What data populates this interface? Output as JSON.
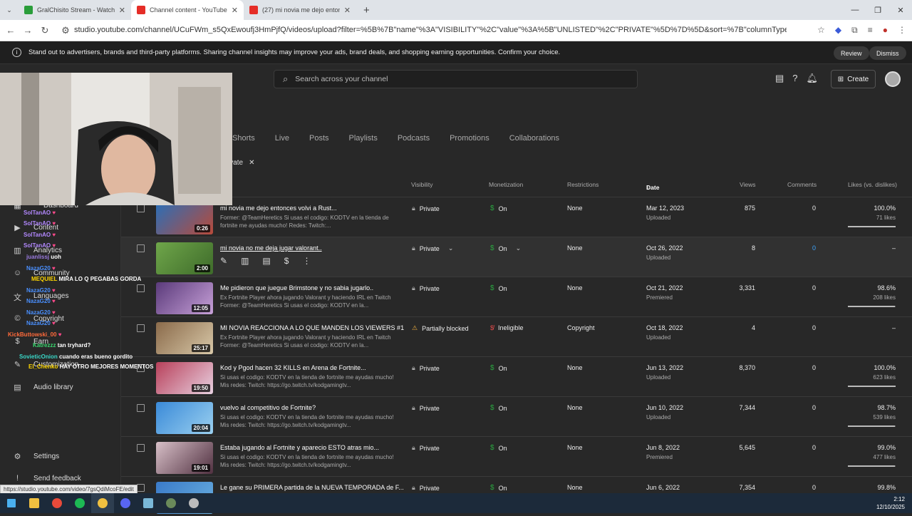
{
  "browser": {
    "tabs": [
      {
        "title": "GralChisito Stream - Watch Live",
        "color": "#2a9d3a"
      },
      {
        "title": "Channel content - YouTube Studio",
        "color": "#e52d27"
      },
      {
        "title": "(27) mi novia me dejo entonces...",
        "color": "#e52d27"
      }
    ],
    "url": "studio.youtube.com/channel/UCuFWm_s5QxEwoufj3HmPjfQ/videos/upload?filter=%5B%7B\"name\"%3A\"VISIBILITY\"%2C\"value\"%3A%5B\"UNLISTED\"%2C\"PRIVATE\"%5D%7D%5D&sort=%7B\"columnType\"%3A\"date\"%2C\"sortOrder\"%3A\"DESCEN..."
  },
  "banner": {
    "text": "Stand out to advertisers, brands and third-party platforms. Sharing channel insights may improve your ads, brand deals, and shopping earning opportunities. Confirm your choice.",
    "review": "Review",
    "dismiss": "Dismiss"
  },
  "header": {
    "search_placeholder": "Search across your channel",
    "create": "Create"
  },
  "tabs": [
    "Shorts",
    "Live",
    "Posts",
    "Playlists",
    "Podcasts",
    "Promotions",
    "Collaborations"
  ],
  "filter_chip": "ivate",
  "sidebar": {
    "items": [
      {
        "label": "Dashboard"
      },
      {
        "label": "Content"
      },
      {
        "label": "Analytics"
      },
      {
        "label": "Community"
      },
      {
        "label": "Languages"
      },
      {
        "label": "Copyright"
      },
      {
        "label": "Earn"
      },
      {
        "label": "Customization"
      },
      {
        "label": "Audio library"
      },
      {
        "label": "Settings"
      },
      {
        "label": "Send feedback"
      }
    ]
  },
  "columns": {
    "visibility": "Visibility",
    "monetization": "Monetization",
    "restrictions": "Restrictions",
    "date": "Date",
    "views": "Views",
    "comments": "Comments",
    "likes": "Likes (vs. dislikes)"
  },
  "rows": [
    {
      "title": "mi novia me dejo entonces volvi a Rust...",
      "desc": "Former: @TeamHeretics Si usas el codigo: KODTV en la tienda de fortnite me ayudas mucho! Redes: Twitch:...",
      "dur": "0:26",
      "vis": "Private",
      "mon": "On",
      "res": "None",
      "date": "Mar 12, 2023",
      "dsub": "Uploaded",
      "views": "875",
      "com": "0",
      "likes": "100.0%",
      "lsub": "71 likes",
      "pct": 1.0,
      "t1": "#2a6fb8",
      "t2": "#b84a3a"
    },
    {
      "title": "mi novia no me deja jugar valorant..",
      "desc": "",
      "dur": "2:00",
      "vis": "Private",
      "mon": "On",
      "res": "None",
      "date": "Oct 26, 2022",
      "dsub": "Uploaded",
      "views": "8",
      "com": "0",
      "likes": "–",
      "lsub": "",
      "pct": null,
      "t1": "#6fa64a",
      "t2": "#3e6b2a",
      "hover": true
    },
    {
      "title": "Me pidieron que juegue Brimstone y no sabia jugarlo..",
      "desc": "Ex Fortnite Player ahora jugando Valorant y haciendo IRL en Twitch Former: @TeamHeretics Si usas el codigo: KODTV en la...",
      "dur": "12:05",
      "vis": "Private",
      "mon": "On",
      "res": "None",
      "date": "Oct 21, 2022",
      "dsub": "Premiered",
      "views": "3,331",
      "com": "0",
      "likes": "98.6%",
      "lsub": "208 likes",
      "pct": 0.986,
      "t1": "#5a3a7a",
      "t2": "#c7a0d8"
    },
    {
      "title": "MI NOVIA REACCIONA A LO QUE MANDEN LOS VIEWERS #1",
      "desc": "Ex Fortnite Player ahora jugando Valorant y haciendo IRL en Twitch Former: @TeamHeretics Si usas el codigo: KODTV en la...",
      "dur": "25:17",
      "vis": "Partially blocked",
      "mon": "Ineligible",
      "res": "Copyright",
      "date": "Oct 18, 2022",
      "dsub": "Uploaded",
      "views": "4",
      "com": "0",
      "likes": "–",
      "lsub": "",
      "pct": null,
      "t1": "#8a6a4a",
      "t2": "#d8c8a8",
      "blocked": true
    },
    {
      "title": "Kod y Pgod hacen 32 KILLS en Arena de Fortnite...",
      "desc": "Si usas el codigo: KODTV en la tienda de fortnite me ayudas mucho! Mis redes: Twitch: https://go.twitch.tv/kodgamingtv...",
      "dur": "19:50",
      "vis": "Private",
      "mon": "On",
      "res": "None",
      "date": "Jun 13, 2022",
      "dsub": "Uploaded",
      "views": "8,370",
      "com": "0",
      "likes": "100.0%",
      "lsub": "623 likes",
      "pct": 1.0,
      "t1": "#b8405a",
      "t2": "#e8d0e0"
    },
    {
      "title": "vuelvo al competitivo de Fortnite?",
      "desc": "Si usas el codigo: KODTV en la tienda de fortnite me ayudas mucho! Mis redes: Twitch: https://go.twitch.tv/kodgamingtv...",
      "dur": "20:04",
      "vis": "Private",
      "mon": "On",
      "res": "None",
      "date": "Jun 10, 2022",
      "dsub": "Uploaded",
      "views": "7,344",
      "com": "0",
      "likes": "98.7%",
      "lsub": "539 likes",
      "pct": 0.987,
      "t1": "#3a8ad8",
      "t2": "#9ad0f0"
    },
    {
      "title": "Estaba jugando al Fortnite y aparecio ESTO atras mio...",
      "desc": "Si usas el codigo: KODTV en la tienda de fortnite me ayudas mucho! Mis redes: Twitch: https://go.twitch.tv/kodgamingtv...",
      "dur": "19:01",
      "vis": "Private",
      "mon": "On",
      "res": "None",
      "date": "Jun 8, 2022",
      "dsub": "Premiered",
      "views": "5,645",
      "com": "0",
      "likes": "99.0%",
      "lsub": "477 likes",
      "pct": 0.99,
      "t1": "#d8c0c8",
      "t2": "#503040"
    },
    {
      "title": "Le gane su PRIMERA partida de la NUEVA TEMPORADA de F...",
      "desc": "",
      "dur": "",
      "vis": "Private",
      "mon": "On",
      "res": "None",
      "date": "Jun 6, 2022",
      "dsub": "",
      "views": "7,354",
      "com": "0",
      "likes": "99.8%",
      "lsub": "",
      "pct": null,
      "t1": "#3a7ac8",
      "t2": "#6ab0e0"
    }
  ],
  "chat": [
    {
      "u": "SolTanAO",
      "m": "",
      "c": "#b388ff"
    },
    {
      "u": "SolTanAO",
      "m": "",
      "c": "#b388ff"
    },
    {
      "u": "SolTanAO",
      "m": "",
      "c": "#b388ff"
    },
    {
      "u": "SolTanAO",
      "m": "",
      "c": "#b388ff"
    },
    {
      "u": "juanlissj",
      "m": "uoh",
      "c": "#9a7adf"
    },
    {
      "u": "NazaG20",
      "m": "",
      "c": "#4a90ff"
    },
    {
      "u": "MEQUIEL",
      "m": "MIRA LO Q PEGABAS GORDA",
      "c": "#ffd700"
    },
    {
      "u": "NazaG20",
      "m": "",
      "c": "#4a90ff"
    },
    {
      "u": "NazaG20",
      "m": "",
      "c": "#4a90ff"
    },
    {
      "u": "NazaG20",
      "m": "",
      "c": "#4a90ff"
    },
    {
      "u": "NazaG20",
      "m": "",
      "c": "#4a90ff"
    },
    {
      "u": "KickButtowski_00",
      "m": "",
      "c": "#ff6a3a"
    },
    {
      "u": "Katrezzz",
      "m": "tan tryhard?",
      "c": "#3ad870"
    },
    {
      "u": "SovieticOnion",
      "m": "cuando eras bueno gordito",
      "c": "#3ad8c8"
    },
    {
      "u": "El_Chenko",
      "m": "HAY OTRO MEJORES MOMENTOS",
      "c": "#ffd700"
    }
  ],
  "status_url": "https://studio.youtube.com/video/7gsQdiMcoFE/edit",
  "clock": {
    "time": "2:12",
    "date": "12/10/2025"
  }
}
